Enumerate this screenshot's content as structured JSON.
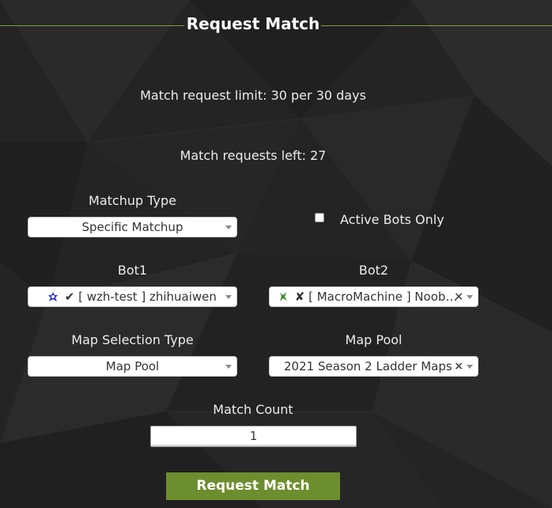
{
  "header": {
    "title": "Request Match"
  },
  "info": {
    "limit_text": "Match request limit: 30 per 30 days",
    "left_text": "Match requests left: 27"
  },
  "matchup": {
    "label": "Matchup Type",
    "value": "Specific Matchup"
  },
  "active_bots": {
    "label": "Active Bots Only",
    "checked": false
  },
  "bot1": {
    "label": "Bot1",
    "value": "✔ [ wzh-test ] zhihuaiwen",
    "race_icon": "protoss-icon"
  },
  "bot2": {
    "label": "Bot2",
    "value": "✘ [ MacroMachine ] Noob…",
    "race_icon": "zerg-icon",
    "clear": "×"
  },
  "map_selection": {
    "label": "Map Selection Type",
    "value": "Map Pool"
  },
  "map_pool": {
    "label": "Map Pool",
    "value": "2021 Season 2 Ladder Maps",
    "clear": "×"
  },
  "match_count": {
    "label": "Match Count",
    "value": "1"
  },
  "submit": {
    "label": "Request Match"
  },
  "colors": {
    "accent": "#6d8e2e",
    "title_line": "#7e9c3b",
    "background": "#232323"
  }
}
